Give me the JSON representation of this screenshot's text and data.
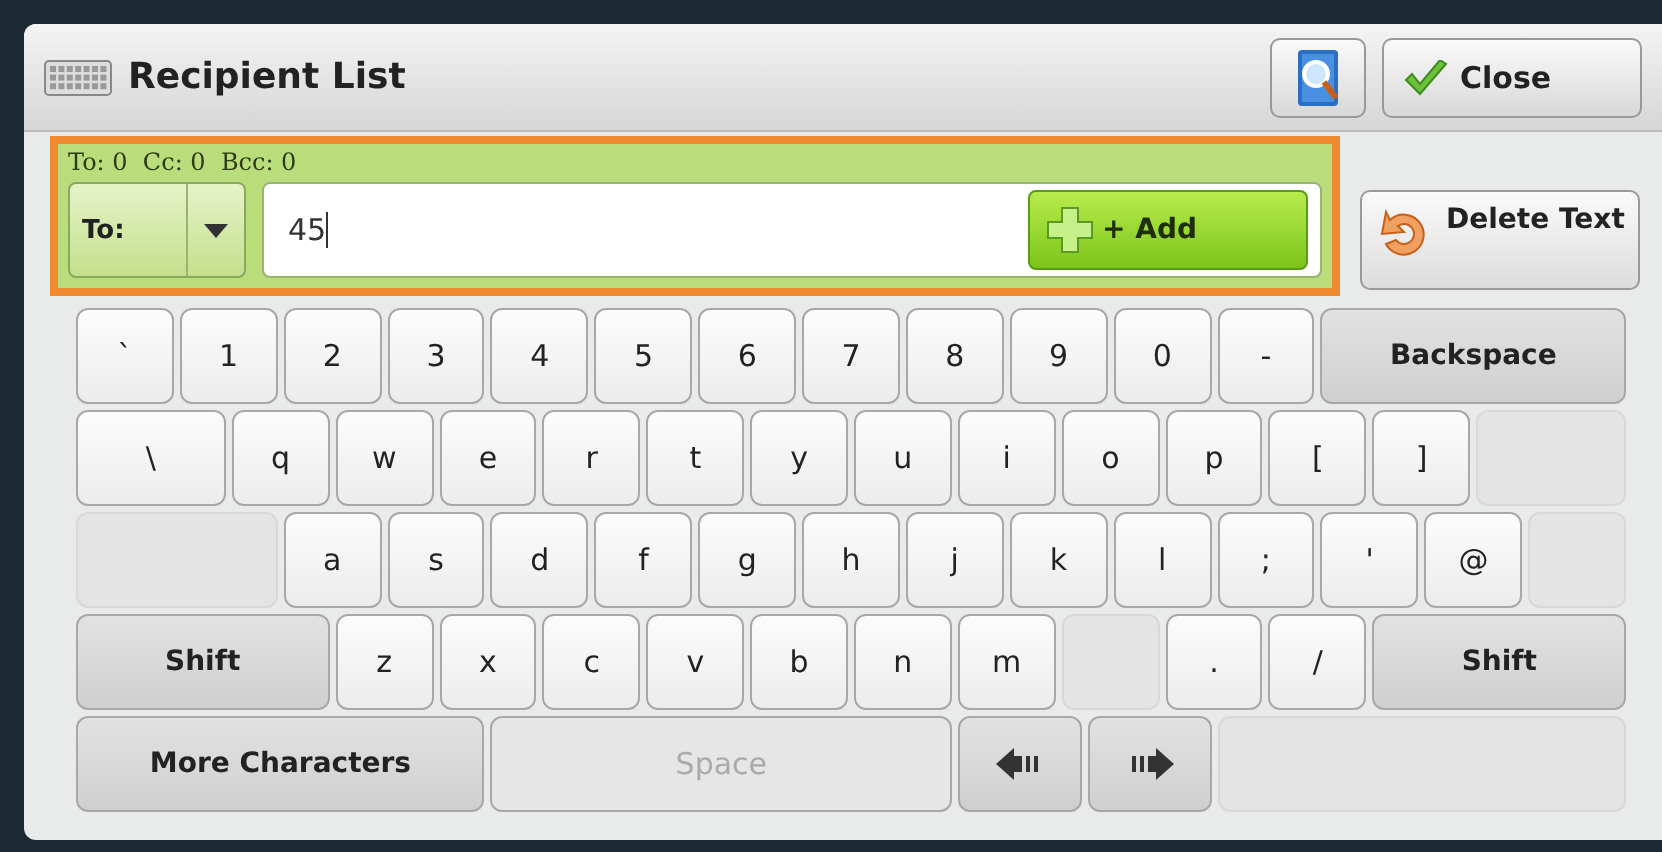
{
  "window": {
    "title": "Recipient List"
  },
  "header_buttons": {
    "close": "Close"
  },
  "recipient": {
    "counts": "To: 0  Cc: 0  Bcc: 0",
    "field_type": "To:",
    "value": "45",
    "add": "+ Add"
  },
  "delete_text": "Delete Text",
  "keyboard": [
    [
      {
        "label": "`",
        "kind": "char",
        "disabled": false
      },
      {
        "label": "1",
        "kind": "char",
        "disabled": false
      },
      {
        "label": "2",
        "kind": "char",
        "disabled": false
      },
      {
        "label": "3",
        "kind": "char",
        "disabled": false
      },
      {
        "label": "4",
        "kind": "char",
        "disabled": false
      },
      {
        "label": "5",
        "kind": "char",
        "disabled": false
      },
      {
        "label": "6",
        "kind": "char",
        "disabled": false
      },
      {
        "label": "7",
        "kind": "char",
        "disabled": false
      },
      {
        "label": "8",
        "kind": "char",
        "disabled": false
      },
      {
        "label": "9",
        "kind": "char",
        "disabled": false
      },
      {
        "label": "0",
        "kind": "char",
        "disabled": false
      },
      {
        "label": "-",
        "kind": "char",
        "disabled": false
      },
      {
        "label": "Backspace",
        "kind": "function",
        "disabled": false
      }
    ],
    [
      {
        "label": "\\",
        "kind": "char",
        "disabled": false
      },
      {
        "label": "q",
        "kind": "char",
        "disabled": false
      },
      {
        "label": "w",
        "kind": "char",
        "disabled": false
      },
      {
        "label": "e",
        "kind": "char",
        "disabled": false
      },
      {
        "label": "r",
        "kind": "char",
        "disabled": false
      },
      {
        "label": "t",
        "kind": "char",
        "disabled": false
      },
      {
        "label": "y",
        "kind": "char",
        "disabled": false
      },
      {
        "label": "u",
        "kind": "char",
        "disabled": false
      },
      {
        "label": "i",
        "kind": "char",
        "disabled": false
      },
      {
        "label": "o",
        "kind": "char",
        "disabled": false
      },
      {
        "label": "p",
        "kind": "char",
        "disabled": false
      },
      {
        "label": "[",
        "kind": "char",
        "disabled": false
      },
      {
        "label": "]",
        "kind": "char",
        "disabled": false
      },
      {
        "kind": "blank",
        "disabled": true
      }
    ],
    [
      {
        "kind": "blank",
        "disabled": true
      },
      {
        "label": "a",
        "kind": "char",
        "disabled": false
      },
      {
        "label": "s",
        "kind": "char",
        "disabled": false
      },
      {
        "label": "d",
        "kind": "char",
        "disabled": false
      },
      {
        "label": "f",
        "kind": "char",
        "disabled": false
      },
      {
        "label": "g",
        "kind": "char",
        "disabled": false
      },
      {
        "label": "h",
        "kind": "char",
        "disabled": false
      },
      {
        "label": "j",
        "kind": "char",
        "disabled": false
      },
      {
        "label": "k",
        "kind": "char",
        "disabled": false
      },
      {
        "label": "l",
        "kind": "char",
        "disabled": false
      },
      {
        "label": ";",
        "kind": "char",
        "disabled": false
      },
      {
        "label": "'",
        "kind": "char",
        "disabled": false
      },
      {
        "label": "@",
        "kind": "char",
        "disabled": false
      },
      {
        "kind": "blank",
        "disabled": true
      }
    ],
    [
      {
        "label": "Shift",
        "kind": "function",
        "disabled": false
      },
      {
        "label": "z",
        "kind": "char",
        "disabled": false
      },
      {
        "label": "x",
        "kind": "char",
        "disabled": false
      },
      {
        "label": "c",
        "kind": "char",
        "disabled": false
      },
      {
        "label": "v",
        "kind": "char",
        "disabled": false
      },
      {
        "label": "b",
        "kind": "char",
        "disabled": false
      },
      {
        "label": "n",
        "kind": "char",
        "disabled": false
      },
      {
        "label": "m",
        "kind": "char",
        "disabled": false
      },
      {
        "kind": "blank",
        "disabled": true
      },
      {
        "label": ".",
        "kind": "char",
        "disabled": false
      },
      {
        "label": "/",
        "kind": "char",
        "disabled": false
      },
      {
        "label": "Shift",
        "kind": "function",
        "disabled": false
      }
    ],
    [
      {
        "label": "More Characters",
        "kind": "function",
        "disabled": false
      },
      {
        "label": "Space",
        "kind": "char",
        "disabled": true
      },
      {
        "kind": "arrow-left",
        "disabled": false
      },
      {
        "kind": "arrow-right",
        "disabled": false
      },
      {
        "kind": "blank",
        "disabled": true
      }
    ]
  ]
}
